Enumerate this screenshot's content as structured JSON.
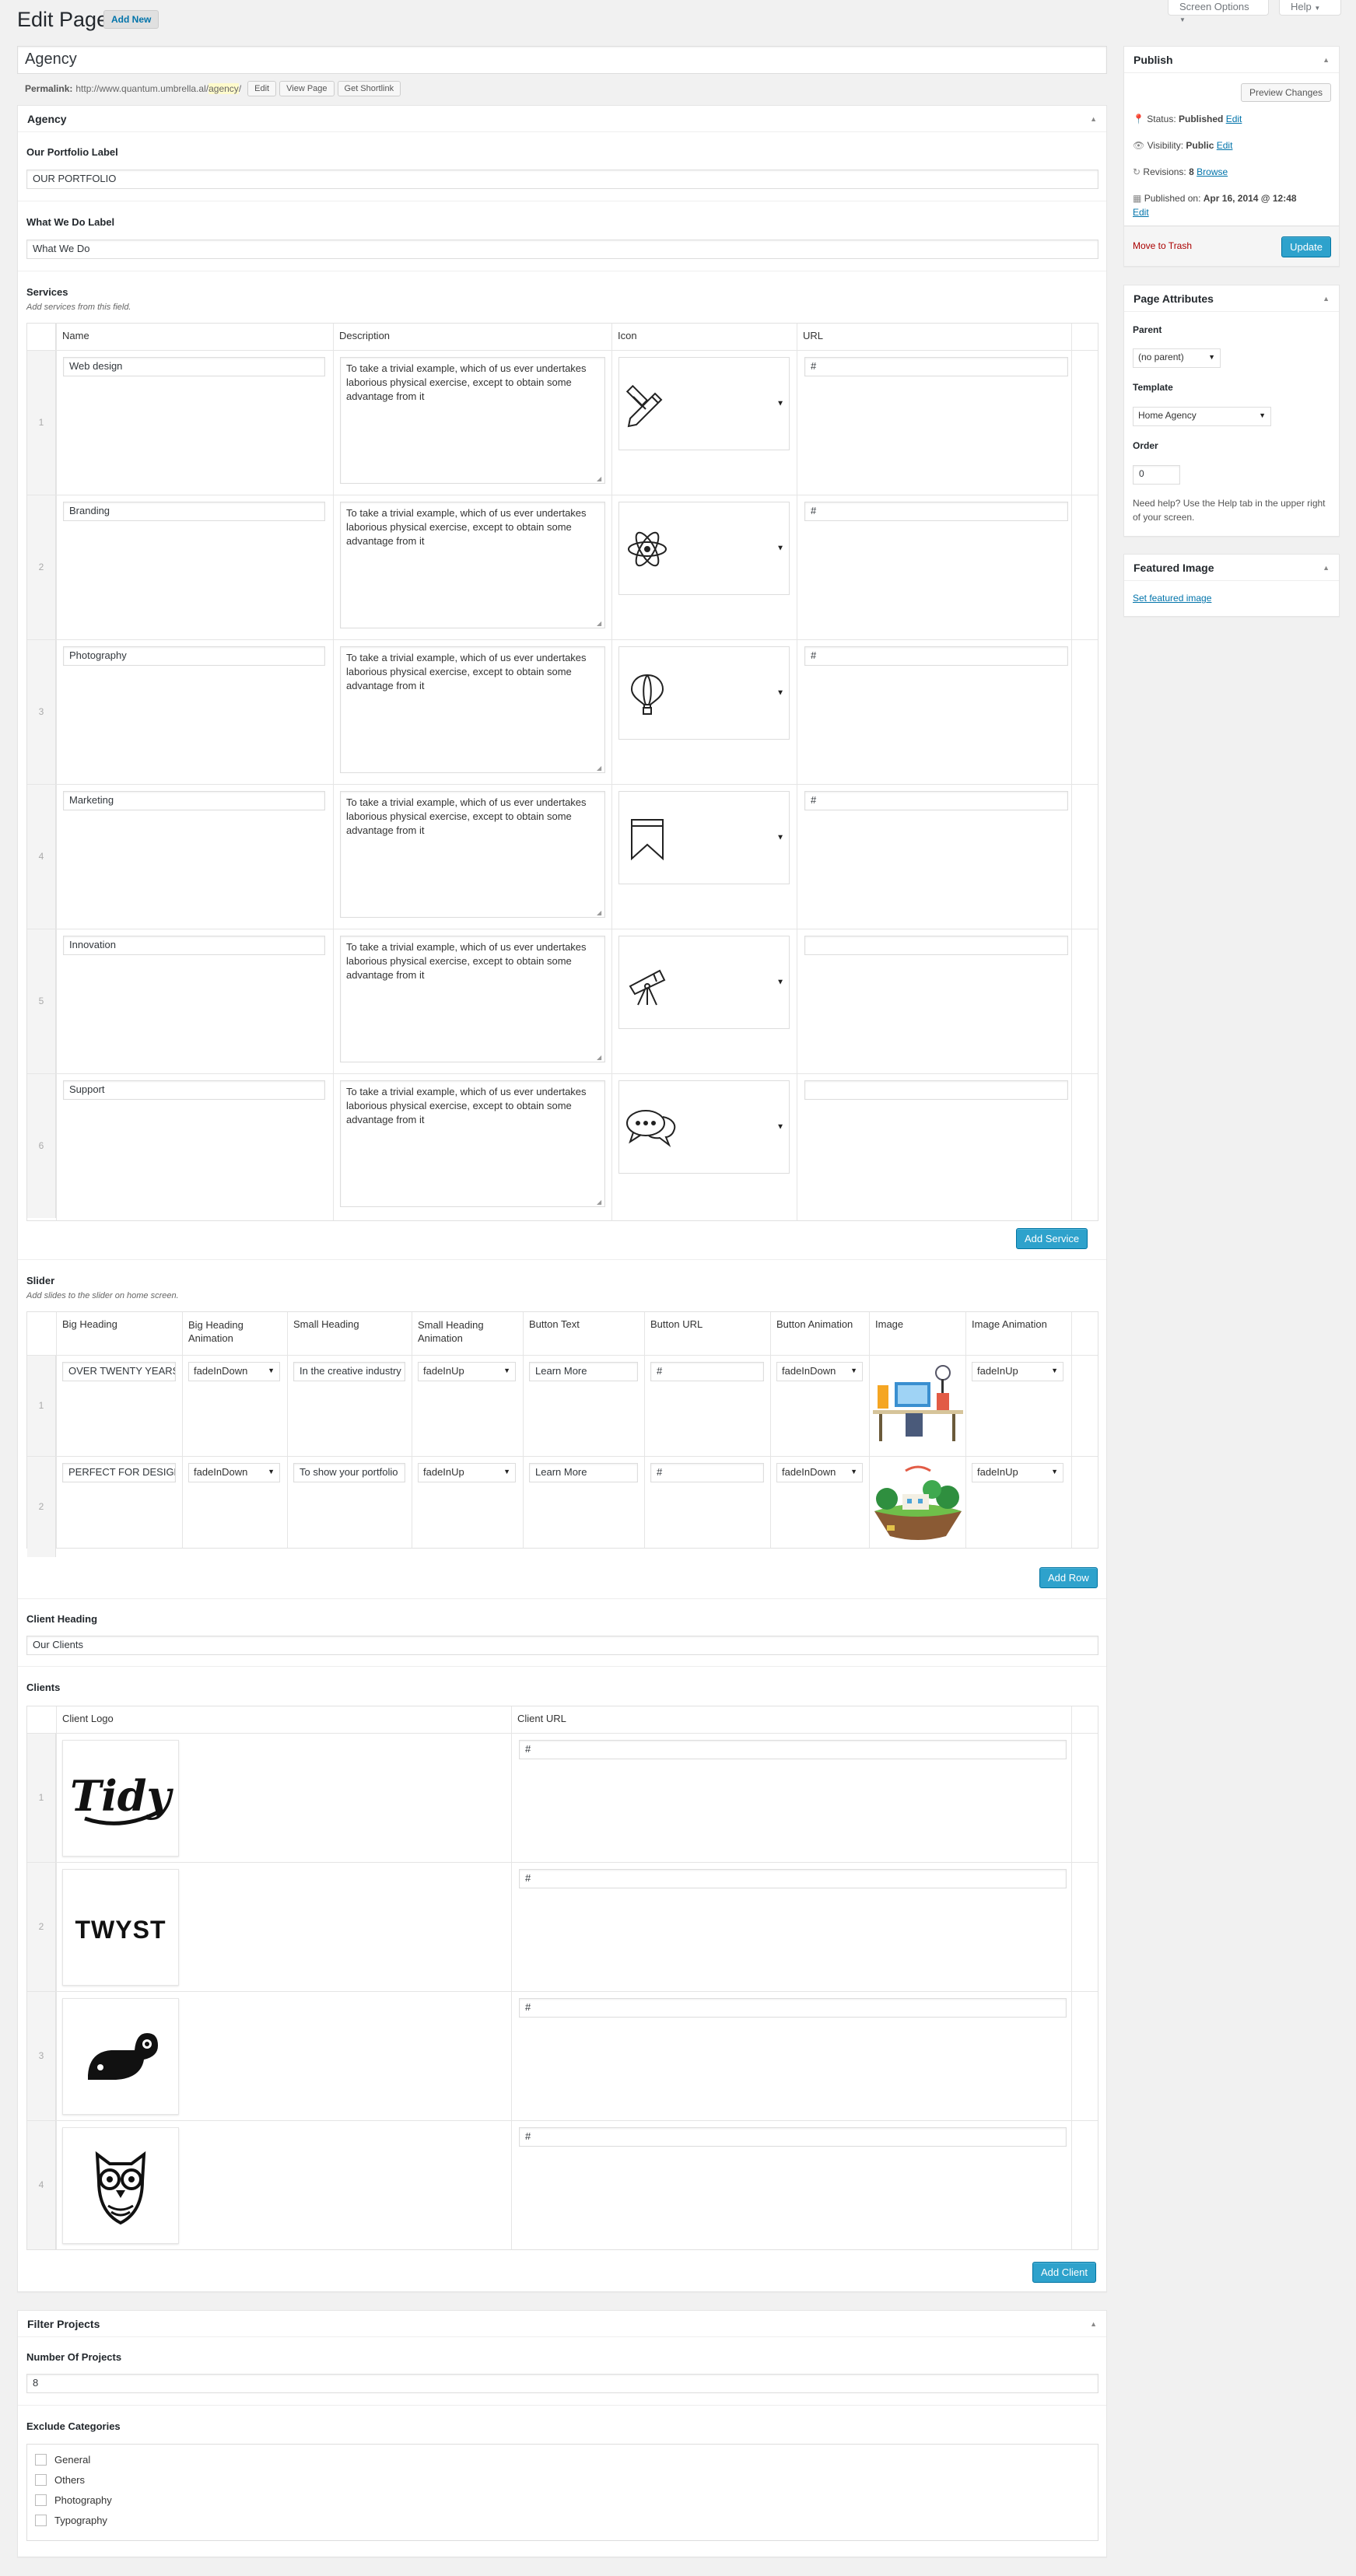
{
  "header": {
    "title": "Edit Page",
    "add_new": "Add New",
    "screen_options": "Screen Options",
    "help": "Help"
  },
  "post": {
    "title": "Agency",
    "permalink_label": "Permalink:",
    "permalink_base": "http://www.quantum.umbrella.al/",
    "permalink_slug": "agency",
    "permalink_end": "/",
    "edit": "Edit",
    "view_page": "View Page",
    "get_shortlink": "Get Shortlink"
  },
  "agency_box": {
    "title": "Agency",
    "portfolio_label": "Our Portfolio Label",
    "portfolio_value": "OUR PORTFOLIO",
    "whatwedo_label": "What We Do Label",
    "whatwedo_value": "What We Do",
    "services_label": "Services",
    "services_desc": "Add services from this field.",
    "services_cols": [
      "Name",
      "Description",
      "Icon",
      "URL"
    ],
    "services": [
      {
        "n": "1",
        "name": "Web design",
        "desc": "To take a trivial example, which of us ever undertakes laborious physical exercise, except to obtain some advantage from it",
        "icon": "pencil-ruler-icon",
        "url": "#"
      },
      {
        "n": "2",
        "name": "Branding",
        "desc": "To take a trivial example, which of us ever undertakes laborious physical exercise, except to obtain some advantage from it",
        "icon": "atom-icon",
        "url": "#"
      },
      {
        "n": "3",
        "name": "Photography",
        "desc": "To take a trivial example, which of us ever undertakes laborious physical exercise, except to obtain some advantage from it",
        "icon": "balloon-icon",
        "url": "#"
      },
      {
        "n": "4",
        "name": "Marketing",
        "desc": "To take a trivial example, which of us ever undertakes laborious physical exercise, except to obtain some advantage from it",
        "icon": "bookmark-icon",
        "url": "#"
      },
      {
        "n": "5",
        "name": "Innovation",
        "desc": "To take a trivial example, which of us ever undertakes laborious physical exercise, except to obtain some advantage from it",
        "icon": "telescope-icon",
        "url": ""
      },
      {
        "n": "6",
        "name": "Support",
        "desc": "To take a trivial example, which of us ever undertakes laborious physical exercise, except to obtain some advantage from it",
        "icon": "chat-bubbles-icon",
        "url": ""
      }
    ],
    "add_service": "Add Service",
    "slider_label": "Slider",
    "slider_desc": "Add slides to the slider on home screen.",
    "slider_cols": [
      "Big Heading",
      "Big Heading Animation",
      "Small Heading",
      "Small Heading Animation",
      "Button Text",
      "Button URL",
      "Button Animation",
      "Image",
      "Image Animation"
    ],
    "slides": [
      {
        "n": "1",
        "big": "OVER TWENTY YEARS",
        "big_anim": "fadeInDown",
        "small": "In the creative industry",
        "small_anim": "fadeInUp",
        "btn_text": "Learn More",
        "btn_url": "#",
        "btn_anim": "fadeInDown",
        "image": "desk-illustration",
        "img_anim": "fadeInUp"
      },
      {
        "n": "2",
        "big": "PERFECT FOR DESIGNERS",
        "big_anim": "fadeInDown",
        "small": "To show your portfolio",
        "small_anim": "fadeInUp",
        "btn_text": "Learn More",
        "btn_url": "#",
        "btn_anim": "fadeInDown",
        "image": "island-illustration",
        "img_anim": "fadeInUp"
      }
    ],
    "add_row": "Add Row",
    "client_heading_label": "Client Heading",
    "client_heading_value": "Our Clients",
    "clients_label": "Clients",
    "clients_cols": [
      "Client Logo",
      "Client URL"
    ],
    "clients": [
      {
        "n": "1",
        "logo": "Tidy",
        "url": "#"
      },
      {
        "n": "2",
        "logo": "TWYST",
        "url": "#"
      },
      {
        "n": "3",
        "logo": "whale-logo",
        "url": "#"
      },
      {
        "n": "4",
        "logo": "owl-logo",
        "url": "#"
      }
    ],
    "add_client": "Add Client"
  },
  "filter_box": {
    "title": "Filter Projects",
    "number_label": "Number Of Projects",
    "number_value": "8",
    "exclude_label": "Exclude Categories",
    "categories": [
      "General",
      "Others",
      "Photography",
      "Typography"
    ]
  },
  "publish": {
    "title": "Publish",
    "preview": "Preview Changes",
    "status_label": "Status:",
    "status": "Published",
    "visibility_label": "Visibility:",
    "visibility": "Public",
    "revisions_label": "Revisions:",
    "revisions": "8",
    "browse": "Browse",
    "published_label": "Published on:",
    "published": "Apr 16, 2014 @ 12:48",
    "edit": "Edit",
    "trash": "Move to Trash",
    "update": "Update"
  },
  "attributes": {
    "title": "Page Attributes",
    "parent_label": "Parent",
    "parent_value": "(no parent)",
    "template_label": "Template",
    "template_value": "Home Agency",
    "order_label": "Order",
    "order_value": "0",
    "help": "Need help? Use the Help tab in the upper right of your screen."
  },
  "featured": {
    "title": "Featured Image",
    "set": "Set featured image"
  },
  "colors": {
    "accent": "#2ea2cc",
    "link": "#0073aa",
    "trash": "#a00"
  }
}
